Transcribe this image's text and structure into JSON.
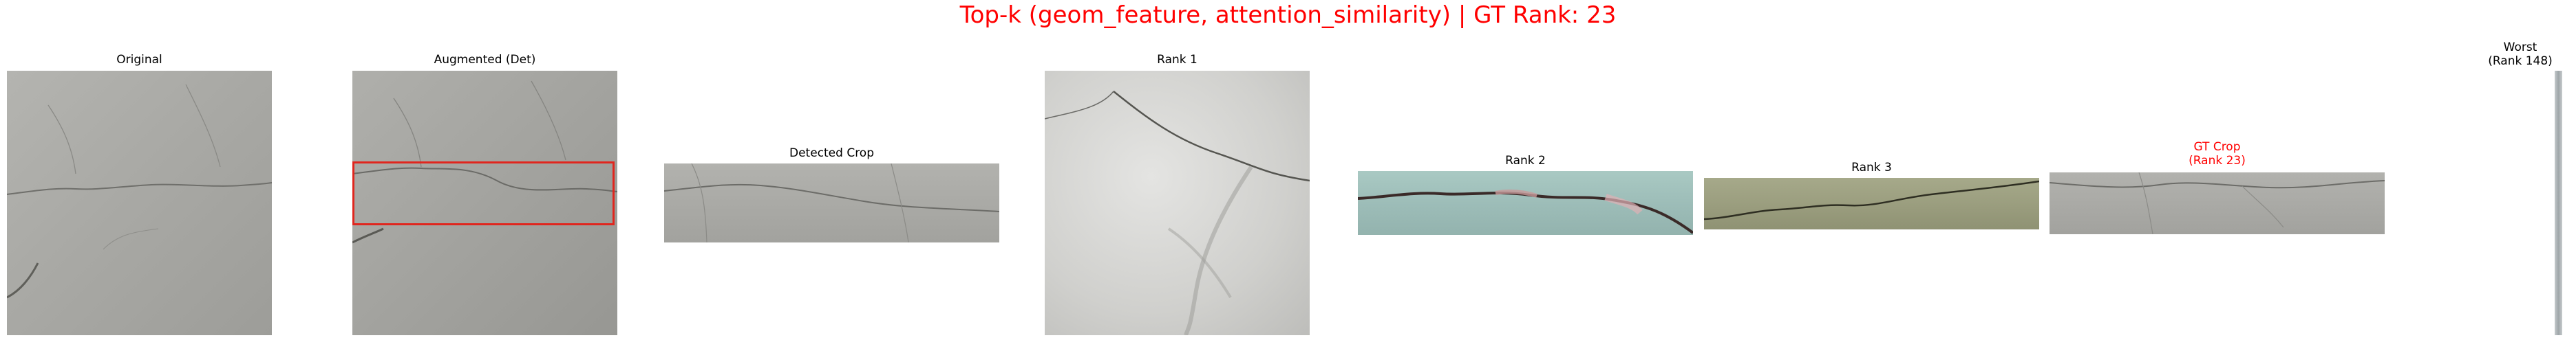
{
  "figure": {
    "title": "Top-k (geom_feature, attention_similarity) | GT Rank: 23",
    "title_color": "#ff0000"
  },
  "panels": [
    {
      "title": "Original"
    },
    {
      "title": "Augmented (Det)",
      "box_color": "#e0261e"
    },
    {
      "title": "Detected Crop"
    },
    {
      "title": "Rank 1"
    },
    {
      "title": "Rank 2"
    },
    {
      "title": "Rank 3"
    },
    {
      "title": "GT Crop\n(Rank 23)",
      "title_color": "#ff0000"
    },
    {
      "title": "Worst\n(Rank 148)"
    }
  ]
}
